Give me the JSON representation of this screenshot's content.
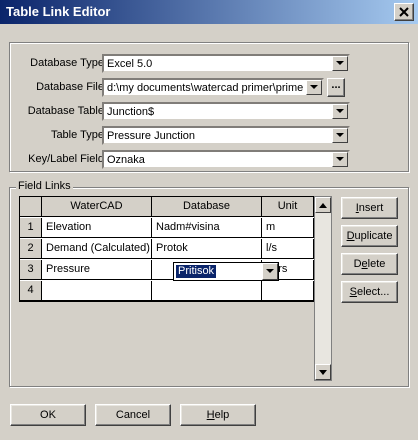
{
  "window": {
    "title": "Table Link Editor"
  },
  "form": {
    "database_type": {
      "label": "Database Type:",
      "value": "Excel 5.0"
    },
    "database_file": {
      "label": "Database File:",
      "value": "d:\\my documents\\watercad primer\\primer.",
      "browse": "..."
    },
    "database_table": {
      "label": "Database Table:",
      "value": "Junction$"
    },
    "table_type": {
      "label": "Table Type:",
      "value": "Pressure Junction"
    },
    "key_field": {
      "label": "Key/Label Field:",
      "value": "Oznaka"
    }
  },
  "field_links": {
    "caption": "Field Links",
    "columns": [
      "WaterCAD",
      "Database",
      "Unit"
    ],
    "rows": [
      {
        "num": "1",
        "watercad": "Elevation",
        "database": "Nadm#visina",
        "unit": "m"
      },
      {
        "num": "2",
        "watercad": "Demand (Calculated)",
        "database": "Protok",
        "unit": "l/s"
      },
      {
        "num": "3",
        "watercad": "Pressure",
        "database": "Pritisok",
        "unit": "bars"
      },
      {
        "num": "4",
        "watercad": "",
        "database": "",
        "unit": ""
      }
    ]
  },
  "side_buttons": {
    "insert": {
      "pre": "",
      "ul": "I",
      "post": "nsert"
    },
    "duplicate": {
      "pre": "",
      "ul": "D",
      "post": "uplicate"
    },
    "delete": {
      "pre": "D",
      "ul": "e",
      "post": "lete"
    },
    "select": {
      "pre": "",
      "ul": "S",
      "post": "elect..."
    }
  },
  "footer": {
    "ok": "OK",
    "cancel": "Cancel",
    "help": {
      "ul": "H",
      "post": "elp"
    }
  },
  "icons": [
    "close-icon",
    "combo-arrow-icon",
    "scroll-up-icon",
    "scroll-down-icon"
  ]
}
